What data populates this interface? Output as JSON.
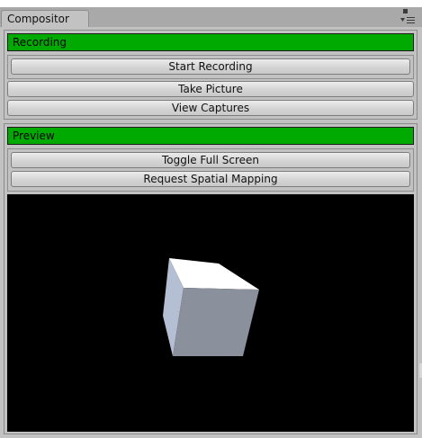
{
  "window": {
    "tab_title": "Compositor"
  },
  "recording": {
    "header": "Recording",
    "start_recording_label": "Start Recording",
    "take_picture_label": "Take Picture",
    "view_captures_label": "View Captures"
  },
  "preview": {
    "header": "Preview",
    "toggle_full_screen_label": "Toggle Full Screen",
    "request_spatial_mapping_label": "Request Spatial Mapping"
  },
  "colors": {
    "header_green": "#00aa00",
    "panel_gray": "#c2c2c2",
    "preview_background": "#000000",
    "cube_top": "#ffffff",
    "cube_front": "#8a8f9c",
    "cube_left": "#b8c2d6"
  },
  "icons": {
    "maximize": "maximize-icon",
    "menu": "context-menu-icon"
  }
}
